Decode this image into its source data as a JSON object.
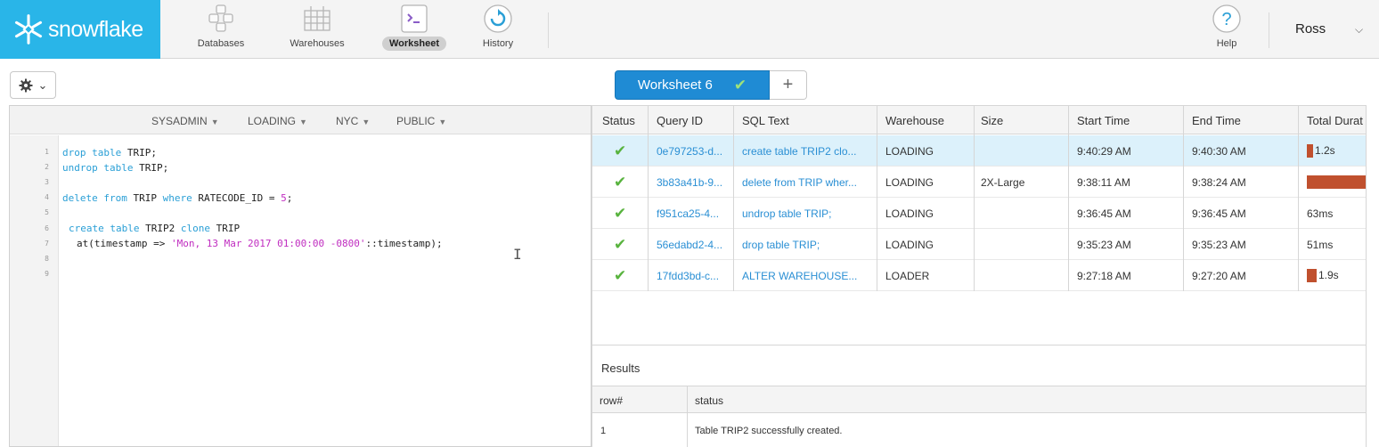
{
  "brand": {
    "name": "snowflake",
    "bg": "#29b5e8"
  },
  "nav": {
    "items": [
      {
        "label": "Databases",
        "icon": "databases-icon"
      },
      {
        "label": "Warehouses",
        "icon": "warehouses-icon"
      },
      {
        "label": "Worksheet",
        "icon": "worksheet-icon",
        "active": true
      },
      {
        "label": "History",
        "icon": "history-icon"
      }
    ],
    "help": {
      "label": "Help",
      "icon": "help-icon"
    },
    "user": "Ross"
  },
  "worksheet": {
    "tab_label": "Worksheet 6",
    "add_label": "+",
    "accent": "#1f8bd4"
  },
  "context": {
    "role": "SYSADMIN",
    "warehouse": "LOADING",
    "database": "NYC",
    "schema": "PUBLIC"
  },
  "editor": {
    "line_numbers": [
      "1",
      "2",
      "3",
      "4",
      "5",
      "6",
      "7",
      "8",
      "9"
    ],
    "lines": [
      "drop table TRIP;",
      "undrop table TRIP;",
      "",
      "delete from TRIP where RATECODE_ID = 5;",
      "",
      " create table TRIP2 clone TRIP",
      "  at(timestamp => 'Mon, 13 Mar 2017 01:00:00 -0800'::timestamp);",
      "",
      ""
    ],
    "tokens": {
      "l1_kw": "drop table",
      "l1_rest": " TRIP;",
      "l2_kw": "undrop table",
      "l2_rest": " TRIP;",
      "l4_kw1": "delete from",
      "l4_mid": " TRIP ",
      "l4_kw2": "where",
      "l4_rest": " RATECODE_ID = ",
      "l4_num": "5",
      "l4_end": ";",
      "l6_kw1": "create table",
      "l6_mid": " TRIP2 ",
      "l6_kw2": "clone",
      "l6_rest": " TRIP",
      "l7_pre": "at(timestamp => ",
      "l7_str": "'Mon, 13 Mar 2017 01:00:00 -0800'",
      "l7_post": "::timestamp);"
    }
  },
  "history": {
    "columns": [
      "Status",
      "Query ID",
      "SQL Text",
      "Warehouse",
      "Size",
      "Start Time",
      "End Time",
      "Total Durat"
    ],
    "rows": [
      {
        "query_id": "0e797253-d...",
        "sql": "create table TRIP2 clo...",
        "warehouse": "LOADING",
        "size": "",
        "start": "9:40:29 AM",
        "end": "9:40:30 AM",
        "duration": "1.2s",
        "bar_fraction": 0.1,
        "selected": true
      },
      {
        "query_id": "3b83a41b-9...",
        "sql": "delete from TRIP wher...",
        "warehouse": "LOADING",
        "size": "2X-Large",
        "start": "9:38:11 AM",
        "end": "9:38:24 AM",
        "duration": "",
        "bar_fraction": 1.0,
        "selected": false
      },
      {
        "query_id": "f951ca25-4...",
        "sql": "undrop table TRIP;",
        "warehouse": "LOADING",
        "size": "",
        "start": "9:36:45 AM",
        "end": "9:36:45 AM",
        "duration": "63ms",
        "bar_fraction": 0,
        "selected": false
      },
      {
        "query_id": "56edabd2-4...",
        "sql": "drop table TRIP;",
        "warehouse": "LOADING",
        "size": "",
        "start": "9:35:23 AM",
        "end": "9:35:23 AM",
        "duration": "51ms",
        "bar_fraction": 0,
        "selected": false
      },
      {
        "query_id": "17fdd3bd-c...",
        "sql": "ALTER WAREHOUSE...",
        "warehouse": "LOADER",
        "size": "",
        "start": "9:27:18 AM",
        "end": "9:27:20 AM",
        "duration": "1.9s",
        "bar_fraction": 0.15,
        "selected": false
      }
    ],
    "success_color": "#58b33e",
    "bar_color": "#c0502e"
  },
  "results": {
    "title": "Results",
    "columns": [
      "row#",
      "status"
    ],
    "rows": [
      {
        "row": "1",
        "status": "Table TRIP2 successfully created."
      }
    ]
  }
}
